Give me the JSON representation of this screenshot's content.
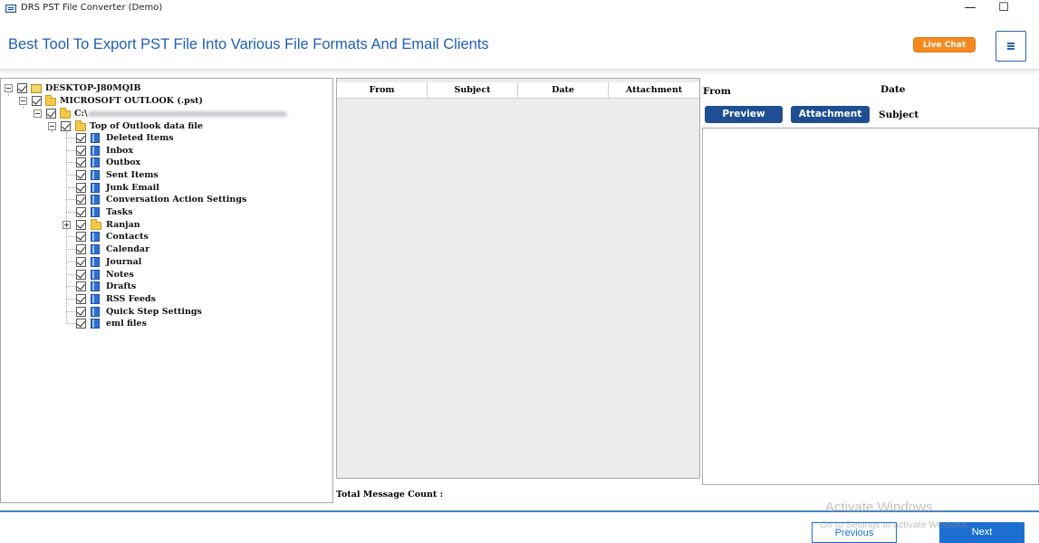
{
  "window": {
    "title": "DRS PST File Converter (Demo)",
    "minimize": "—",
    "maximize": "☐",
    "close": "✕"
  },
  "header": {
    "title": "Best Tool To Export PST File Into Various File Formats And Email Clients",
    "live_chat": "Live Chat",
    "menu_icon": "hamburger-icon"
  },
  "tree": {
    "root": "DESKTOP-J80MQIB",
    "outlook": "MICROSOFT OUTLOOK (.pst)",
    "path_prefix": "C:\\",
    "top_folder": "Top of Outlook data file",
    "folders": [
      "Deleted Items",
      "Inbox",
      "Outbox",
      "Sent Items",
      "Junk Email",
      "Conversation Action Settings",
      "Tasks",
      "Ranjan",
      "Contacts",
      "Calendar",
      "Journal",
      "Notes",
      "Drafts",
      "RSS Feeds",
      "Quick Step Settings",
      "eml files"
    ]
  },
  "message_list": {
    "columns": [
      "From",
      "Subject",
      "Date",
      "Attachment"
    ],
    "total_label": "Total Message Count :"
  },
  "preview": {
    "from_label": "From",
    "date_label": "Date",
    "subject_label": "Subject",
    "preview_button": "Preview",
    "attachment_button": "Attachment"
  },
  "footer": {
    "previous": "Previous",
    "next": "Next",
    "watermark_title": "Activate Windows",
    "watermark_sub": "Go to Settings to activate Windows."
  },
  "colors": {
    "accent": "#1e5fb5",
    "button_dark": "#1f4f92",
    "live_chat": "#f58a1f",
    "next_button": "#1c6fd1"
  }
}
